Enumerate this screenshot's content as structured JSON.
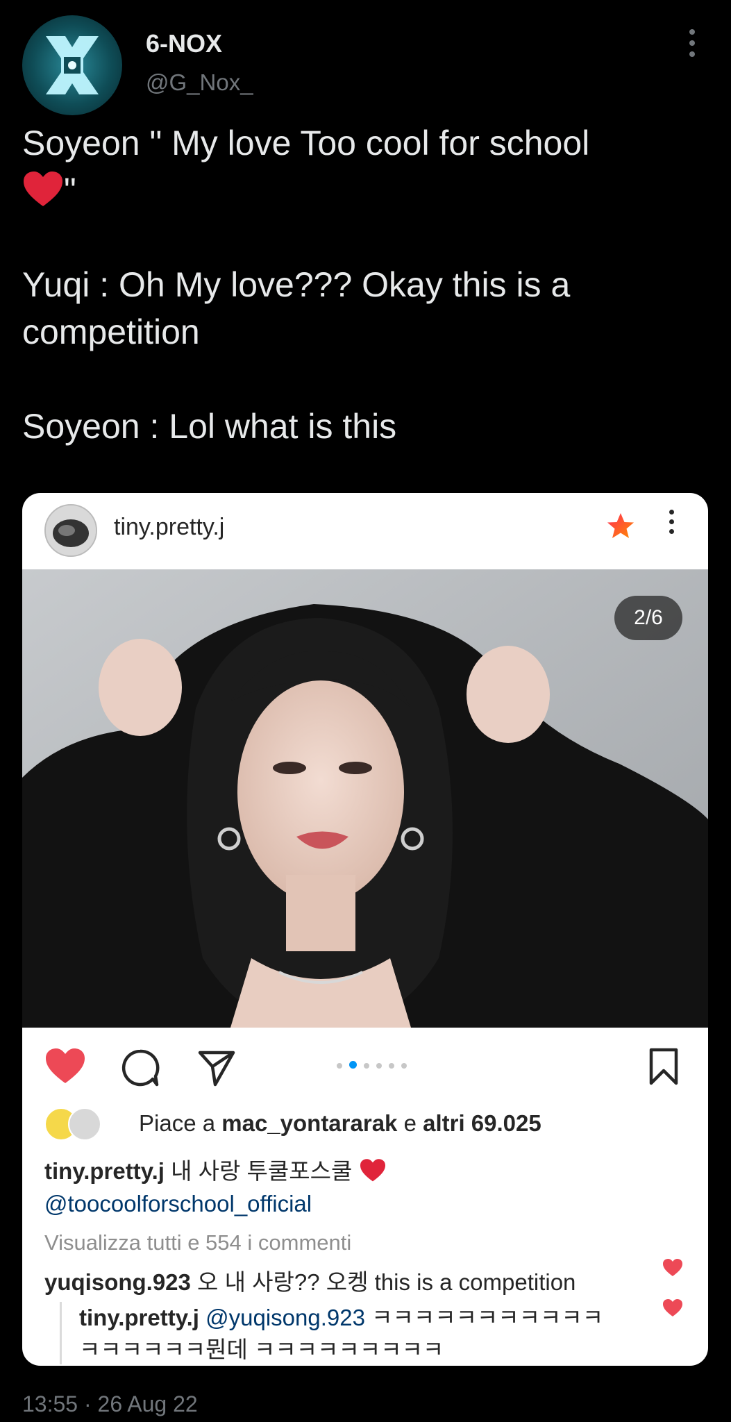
{
  "tweet": {
    "author_name": "6-NOX",
    "author_handle": "@G_Nox_",
    "line1": "Soyeon \" My love Too cool for school",
    "line1_end": "\"",
    "line2": "Yuqi : Oh My love??? Okay this is a",
    "line3": "competition",
    "line4": "Soyeon : Lol what is this",
    "timestamp": "13:55 · 26 Aug 22"
  },
  "ig_post": {
    "username": "tiny.pretty.j",
    "image_counter": "2/6",
    "likes_prefix": "Piace a ",
    "likes_user": "mac_yontararak",
    "likes_mid": " e ",
    "likes_others": "altri 69.025",
    "caption_user": "tiny.pretty.j",
    "caption_text": " 내 사랑 투쿨포스쿨",
    "caption_mention": "@toocoolforschool_official",
    "view_all": "Visualizza tutti e 554 i commenti",
    "comment1_user": "yuqisong.923",
    "comment1_text": " 오 내 사랑?? 오켕 this is a competition",
    "reply_user": "tiny.pretty.j",
    "reply_mention": "@yuqisong.923",
    "reply_text_1": " ㅋㅋㅋㅋㅋㅋㅋㅋㅋㅋㅋ",
    "reply_text_2": "ㅋㅋㅋㅋㅋㅋ뭔데 ㅋㅋㅋㅋㅋㅋㅋㅋㅋ"
  },
  "colors": {
    "background": "#000000",
    "text_primary": "#e7e9ea",
    "text_secondary": "#71767b",
    "like_red": "#ed4956",
    "link_blue": "#00376b",
    "carousel_active": "#0095f6"
  },
  "icons": [
    "avatar-x-logo",
    "more-vertical-icon",
    "heart-emoji",
    "star-icon",
    "heart-icon",
    "comment-icon",
    "share-icon",
    "bookmark-icon"
  ]
}
